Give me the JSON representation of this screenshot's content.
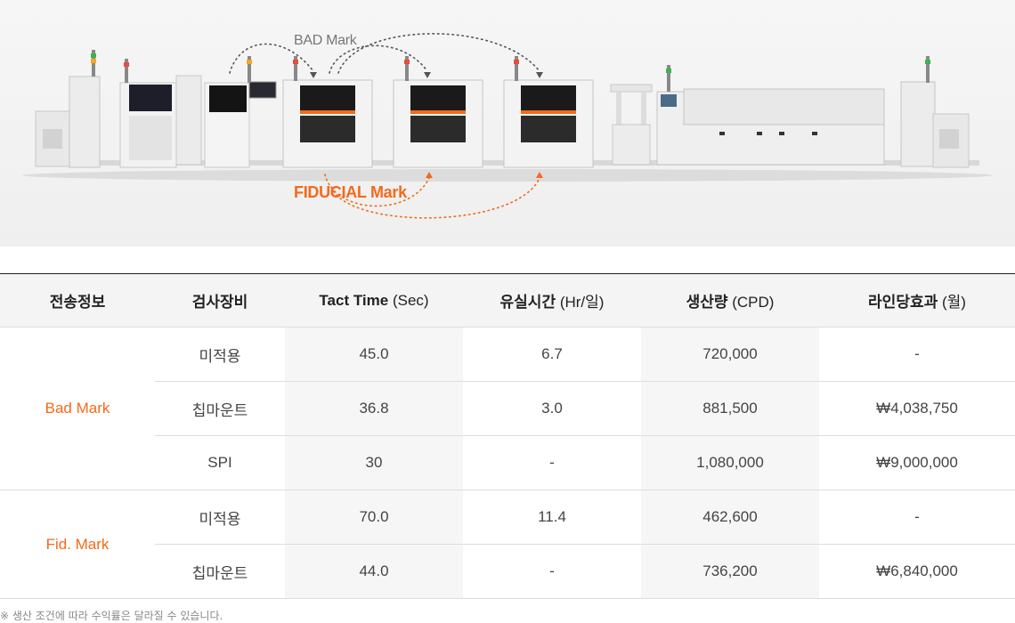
{
  "diagram": {
    "bad_label": "BAD Mark",
    "fid_label": "FIDUCIAL Mark",
    "bad_color": "#777777",
    "fid_color": "#f26a1b"
  },
  "table": {
    "headers": [
      {
        "main": "전송정보",
        "unit": ""
      },
      {
        "main": "검사장비",
        "unit": ""
      },
      {
        "main": "Tact Time",
        "unit": "(Sec)"
      },
      {
        "main": "유실시간",
        "unit": "(Hr/일)"
      },
      {
        "main": "생산량",
        "unit": "(CPD)"
      },
      {
        "main": "라인당효과",
        "unit": "(월)"
      }
    ],
    "groups": [
      {
        "name": "Bad Mark",
        "rows": [
          {
            "equip": "미적용",
            "tact": "45.0",
            "loss": "6.7",
            "cpd": "720,000",
            "effect": "-"
          },
          {
            "equip": "칩마운트",
            "tact": "36.8",
            "loss": "3.0",
            "cpd": "881,500",
            "effect": "₩4,038,750"
          },
          {
            "equip": "SPI",
            "tact": "30",
            "loss": "-",
            "cpd": "1,080,000",
            "effect": "₩9,000,000"
          }
        ]
      },
      {
        "name": "Fid. Mark",
        "rows": [
          {
            "equip": "미적용",
            "tact": "70.0",
            "loss": "11.4",
            "cpd": "462,600",
            "effect": "-"
          },
          {
            "equip": "칩마운트",
            "tact": "44.0",
            "loss": "-",
            "cpd": "736,200",
            "effect": "₩6,840,000"
          }
        ]
      }
    ]
  },
  "note": "※ 생산 조건에 따라 수익률은 달라질 수 있습니다."
}
